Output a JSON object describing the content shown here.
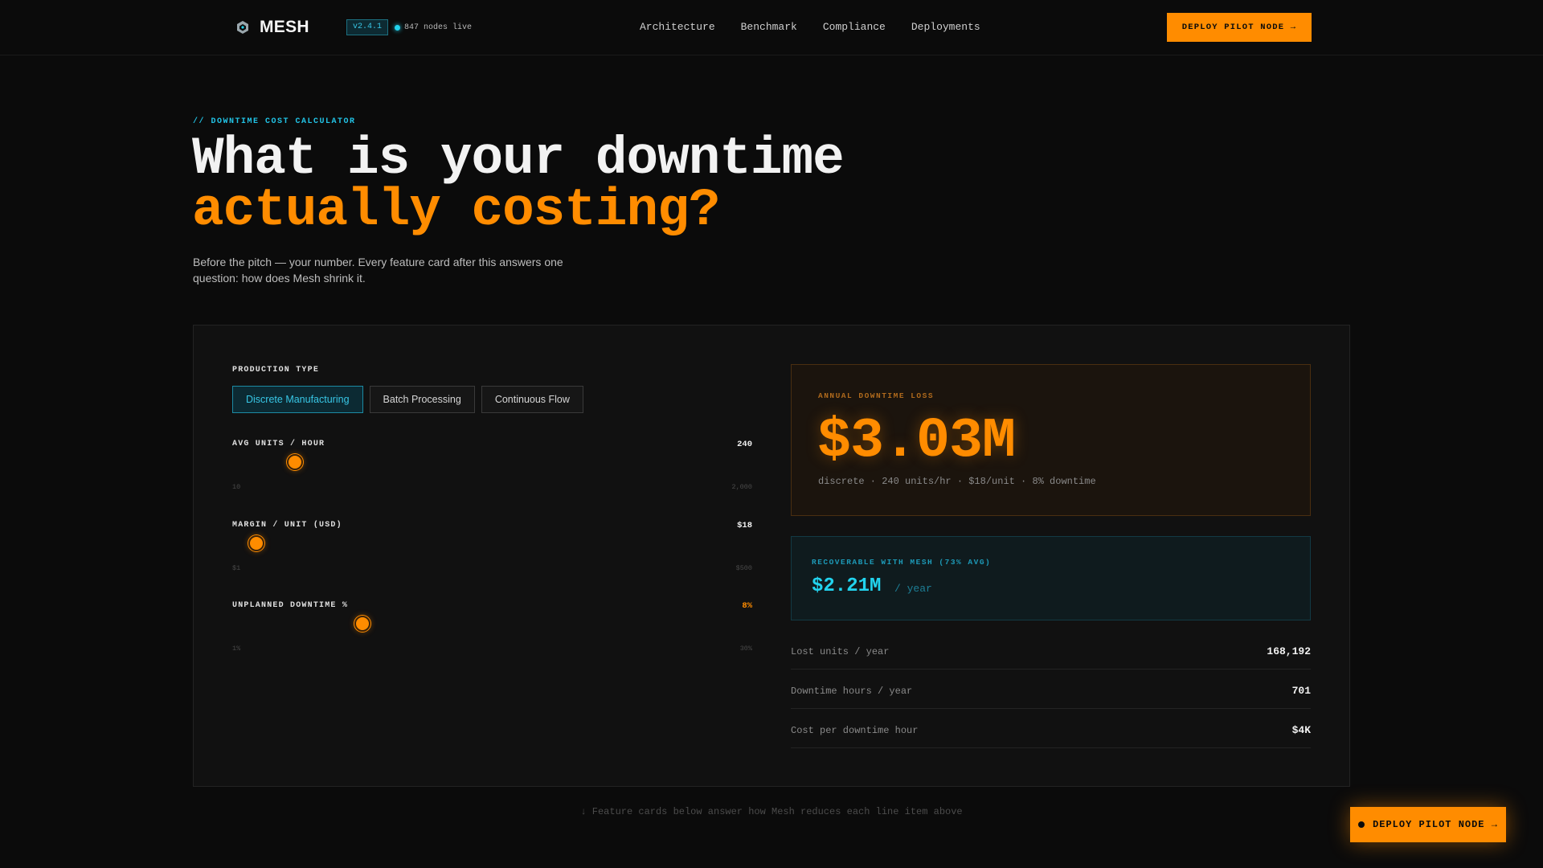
{
  "nav": {
    "brand": "MESH",
    "version": "v2.4.1",
    "live_status": "847 nodes live",
    "links": [
      "Architecture",
      "Benchmark",
      "Compliance",
      "Deployments"
    ],
    "cta": "DEPLOY PILOT NODE →"
  },
  "hero": {
    "eyebrow": "// DOWNTIME COST CALCULATOR",
    "title_line1": "What is your downtime",
    "title_line2": "actually costing?",
    "lede": "Before the pitch — your number. Every feature card after this answers one question: how does Mesh shrink it."
  },
  "calculator": {
    "production_type_label": "PRODUCTION TYPE",
    "production_types": [
      "Discrete Manufacturing",
      "Batch Processing",
      "Continuous Flow"
    ],
    "selected_production_type": "Discrete Manufacturing",
    "sliders": [
      {
        "label": "AVG UNITS / HOUR",
        "value": "240",
        "min": "10",
        "max": "2,000",
        "fraction": 0.12
      },
      {
        "label": "MARGIN / UNIT (USD)",
        "value": "$18",
        "min": "$1",
        "max": "$500",
        "fraction": 0.047
      },
      {
        "label": "UNPLANNED DOWNTIME %",
        "value": "8%",
        "min": "1%",
        "max": "30%",
        "fraction": 0.25
      }
    ],
    "annual_loss": {
      "label": "ANNUAL DOWNTIME LOSS",
      "value": "$3.03M",
      "summary": "discrete · 240 units/hr · $18/unit · 8% downtime"
    },
    "recoverable": {
      "label": "RECOVERABLE WITH MESH (73% AVG)",
      "value": "$2.21M",
      "unit": "/ year"
    },
    "stats": [
      {
        "label": "Lost units / year",
        "value": "168,192"
      },
      {
        "label": "Downtime hours / year",
        "value": "701"
      },
      {
        "label": "Cost per downtime hour",
        "value": "$4K"
      }
    ]
  },
  "footnote": "↓ Feature cards below answer how Mesh reduces each line item above",
  "floating_cta": "DEPLOY PILOT NODE →",
  "colors": {
    "accent": "#ff8c00",
    "cyan": "#22d3ee",
    "background": "#0b0b0b"
  }
}
